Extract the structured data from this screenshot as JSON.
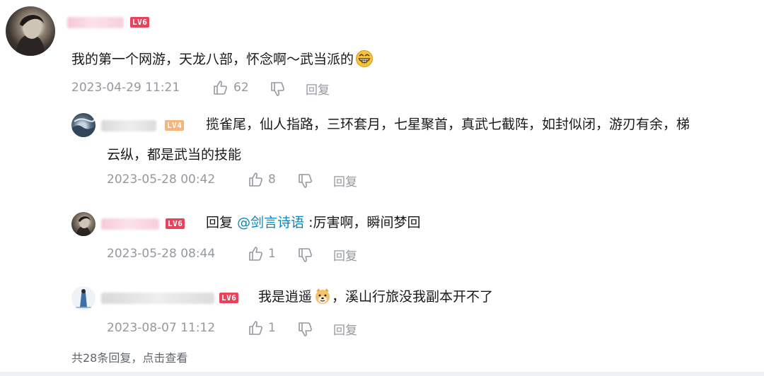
{
  "main_comment": {
    "level": "LV6",
    "text": "我的第一个网游，天龙八部，怀念啊～武当派的",
    "emoji": "grinning-emoji",
    "time": "2023-04-29 11:21",
    "likes": "62",
    "reply_label": "回复"
  },
  "replies": [
    {
      "level": "LV4",
      "text_line1": "揽雀尾，仙人指路，三环套月，七星聚首，真武七截阵，如封似闭，游刃有余，梯",
      "text_line2": "云纵，都是武当的技能",
      "time": "2023-05-28 00:42",
      "likes": "8",
      "reply_label": "回复"
    },
    {
      "level": "LV6",
      "prefix": "回复",
      "mention": "@剑言诗语",
      "text": ":厉害啊，瞬间梦回",
      "time": "2023-05-28 08:44",
      "likes": "1",
      "reply_label": "回复"
    },
    {
      "level": "LV6",
      "text_before": "我是逍遥",
      "emoji": "doge-emoji",
      "text_after": "，溪山行旅没我副本开不了",
      "time": "2023-08-07 11:12",
      "likes": "1",
      "reply_label": "回复"
    }
  ],
  "footer": {
    "more_replies": "共28条回复，点击查看"
  },
  "colors": {
    "level_badge": "#e9435a",
    "level_badge_lv4": "#f5b57a",
    "mention": "#008ac5",
    "meta_text": "#9499a0"
  }
}
